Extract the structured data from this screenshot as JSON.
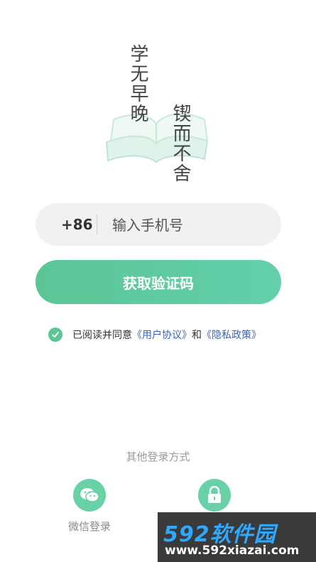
{
  "hero": {
    "column1": "学无早晚",
    "column2": "锲而不舍"
  },
  "phone": {
    "country_code": "+86",
    "placeholder": "输入手机号",
    "value": ""
  },
  "get_code_button": "获取验证码",
  "agreement": {
    "prefix": "已阅读并同意",
    "user_agreement": "《用户协议》",
    "and": "和",
    "privacy_policy": "《隐私政策》",
    "checked": true
  },
  "other_login": {
    "title": "其他登录方式",
    "options": [
      {
        "label": "微信登录",
        "icon": "wechat-icon"
      },
      {
        "label": "",
        "icon": "lock-icon"
      }
    ]
  },
  "watermark": {
    "brand": "592软件园",
    "url": "www.592xiazai.com"
  },
  "colors": {
    "accent": "#5cc596",
    "link": "#3a64b4",
    "input_bg": "#f1f1f1"
  }
}
